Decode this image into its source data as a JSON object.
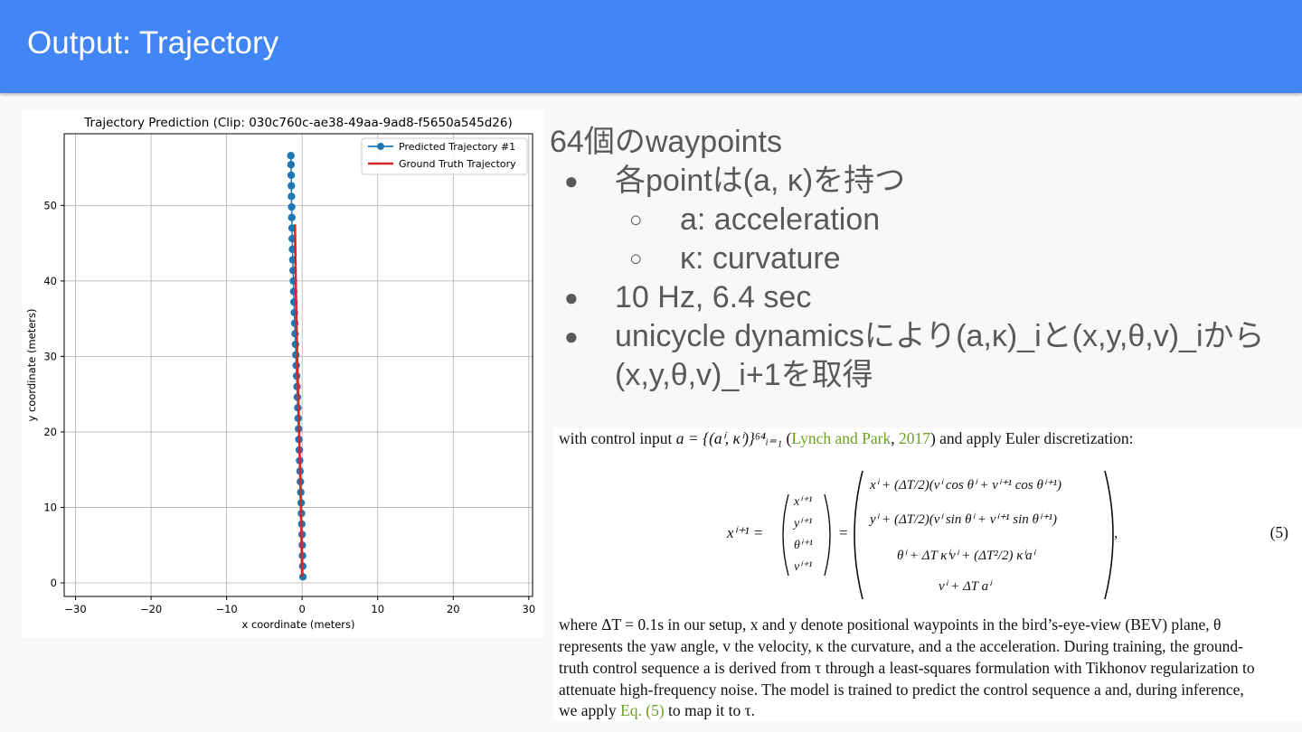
{
  "header": {
    "title": "Output: Trajectory"
  },
  "bullets": {
    "heading": "64個のwaypoints",
    "items": [
      {
        "level": 1,
        "marker": "●",
        "text": "各pointは(a, κ)を持つ"
      },
      {
        "level": 2,
        "marker": "○",
        "text": "a: acceleration"
      },
      {
        "level": 2,
        "marker": "○",
        "text": "κ: curvature"
      },
      {
        "level": 1,
        "marker": "●",
        "text": "10 Hz, 6.4 sec"
      },
      {
        "level": 1,
        "marker": "●",
        "text": "unicycle dynamicsにより(a,κ)_iと(x,y,θ,v)_iから"
      },
      {
        "level": 0,
        "marker": "",
        "text": "(x,y,θ,v)_i+1を取得"
      }
    ]
  },
  "paper": {
    "line1_pre": "with control input ",
    "line1_math": "a = {(aⁱ, κⁱ)}⁶⁴ᵢ₌₁",
    "line1_cite_open": " (",
    "line1_cite_author": "Lynch and Park",
    "line1_cite_sep": ", ",
    "line1_cite_year": "2017",
    "line1_post": ") and apply Euler discretization:",
    "equation": {
      "lhs": "xⁱ⁺¹ =",
      "vector": [
        "xⁱ⁺¹",
        "yⁱ⁺¹",
        "θⁱ⁺¹",
        "vⁱ⁺¹"
      ],
      "eq": "=",
      "rhs": [
        "xⁱ + (ΔT/2)(vⁱ cos θⁱ + vⁱ⁺¹ cos θⁱ⁺¹)",
        "yⁱ + (ΔT/2)(vⁱ sin θⁱ + vⁱ⁺¹ sin θⁱ⁺¹)",
        "θⁱ + ΔT κⁱvⁱ + (ΔT²/2) κⁱaⁱ",
        "vⁱ + ΔT aⁱ"
      ],
      "comma": ",",
      "number": "(5)"
    },
    "para": [
      "where ΔT = 0.1s in our setup, x and y denote positional waypoints in the bird’s-eye-view (BEV) plane, θ",
      "represents the yaw angle, v the velocity, κ the curvature, and a the acceleration. During training, the ground-",
      "truth control sequence a is derived from τ through a least-squares formulation with Tikhonov regularization to",
      "attenuate high-frequency noise. The model is trained to predict the control sequence a and, during inference,"
    ],
    "last_pre": "we apply ",
    "last_link": "Eq. (5)",
    "last_post": " to map it to τ."
  },
  "chart_data": {
    "type": "line",
    "title": "Trajectory Prediction (Clip: 030c760c-ae38-49aa-9ad8-f5650a545d26)",
    "xlabel": "x coordinate (meters)",
    "ylabel": "y coordinate (meters)",
    "xlim": [
      -31.5,
      30.5
    ],
    "ylim": [
      -1.8,
      59.5
    ],
    "xticks": [
      -30,
      -20,
      -10,
      0,
      10,
      20,
      30
    ],
    "yticks": [
      0,
      10,
      20,
      30,
      40,
      50
    ],
    "grid": true,
    "legend": "top-right",
    "series": [
      {
        "name": "Predicted Trajectory #1",
        "color": "#1f77b4",
        "marker": "circle",
        "x": [
          0.1,
          0.08,
          0.05,
          0.02,
          -0.01,
          -0.05,
          -0.09,
          -0.13,
          -0.18,
          -0.23,
          -0.28,
          -0.33,
          -0.38,
          -0.43,
          -0.48,
          -0.53,
          -0.58,
          -0.63,
          -0.68,
          -0.73,
          -0.78,
          -0.83,
          -0.88,
          -0.93,
          -0.98,
          -1.03,
          -1.08,
          -1.12,
          -1.16,
          -1.2,
          -1.24,
          -1.28,
          -1.31,
          -1.34,
          -1.37,
          -1.39,
          -1.41,
          -1.43,
          -1.45,
          -1.47,
          -1.49
        ],
        "y": [
          0.8,
          2.2,
          3.6,
          5.0,
          6.4,
          7.8,
          9.2,
          10.6,
          12.0,
          13.4,
          14.8,
          16.2,
          17.6,
          19.0,
          20.4,
          21.8,
          23.2,
          24.6,
          26.0,
          27.4,
          28.8,
          30.2,
          31.6,
          33.0,
          34.4,
          35.8,
          37.2,
          38.6,
          40.0,
          41.4,
          42.8,
          44.2,
          45.6,
          47.0,
          48.4,
          49.8,
          51.2,
          52.6,
          54.0,
          55.4,
          56.6
        ]
      },
      {
        "name": "Ground Truth Trajectory",
        "color": "#d62728",
        "marker": "none",
        "x": [
          0.0,
          -0.12,
          -0.3,
          -0.5,
          -0.7,
          -0.85,
          -0.95
        ],
        "y": [
          0.8,
          8.0,
          16.0,
          24.0,
          32.0,
          40.0,
          47.5
        ]
      }
    ]
  }
}
